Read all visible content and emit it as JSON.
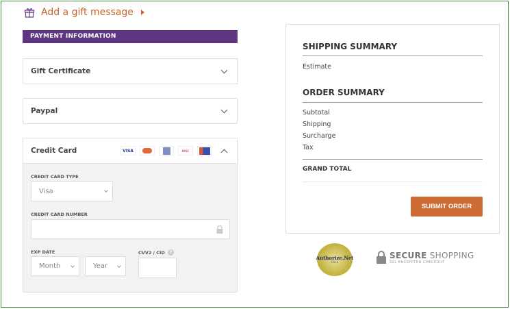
{
  "gift": {
    "label": "Add a gift message",
    "icon": "gift-icon"
  },
  "payment": {
    "title": "PAYMENT INFORMATION",
    "sections": [
      {
        "label": "Gift Certificate"
      },
      {
        "label": "Paypal"
      },
      {
        "label": "Credit Card"
      }
    ],
    "card_logos": [
      "VISA",
      "MC",
      "AMEX",
      "DISCOVER",
      "JCB"
    ],
    "credit_card": {
      "type_label": "CREDIT CARD TYPE",
      "type_value": "Visa",
      "number_label": "CREDIT CARD NUMBER",
      "number_value": "",
      "exp_label": "EXP DATE",
      "month_placeholder": "Month",
      "year_placeholder": "Year",
      "cvv_label": "CVV2 / CID",
      "cvv_value": ""
    }
  },
  "summary": {
    "shipping_title": "SHIPPING SUMMARY",
    "estimate": "Estimate",
    "order_title": "ORDER SUMMARY",
    "rows": [
      "Subtotal",
      "Shipping",
      "Surcharge",
      "Tax"
    ],
    "grand_total": "GRAND TOTAL",
    "submit": "SUBMIT ORDER"
  },
  "badges": {
    "authorize": "Authorize.Net",
    "authorize_click": "Click",
    "secure_bold": "SECURE",
    "secure_rest": "SHOPPING",
    "secure_sub": "SSL ENCRYPTED CHECKOUT"
  },
  "colors": {
    "accent": "#5e3580",
    "button": "#cd6b34",
    "link": "#c8602c"
  }
}
